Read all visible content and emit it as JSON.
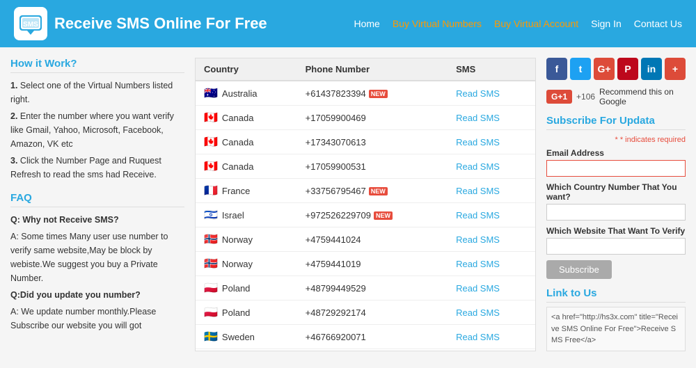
{
  "header": {
    "title": "Receive SMS Online For Free",
    "nav": [
      {
        "label": "Home",
        "class": "normal"
      },
      {
        "label": "Buy Virtual Numbers",
        "class": "orange"
      },
      {
        "label": "Buy Virtual Account",
        "class": "orange"
      },
      {
        "label": "Sign In",
        "class": "normal"
      },
      {
        "label": "Contact Us",
        "class": "normal"
      }
    ]
  },
  "left": {
    "howItWorks": {
      "title": "How it Work?",
      "steps": [
        {
          "num": "1.",
          "text": "Select one of the Virtual Numbers listed right."
        },
        {
          "num": "2.",
          "text": "Enter the number where you want verify like Gmail, Yahoo, Microsoft, Facebook, Amazon, VK etc"
        },
        {
          "num": "3.",
          "text": "Click the Number Page and Ruquest Refresh to read the sms had Receive."
        }
      ]
    },
    "faq": {
      "title": "FAQ",
      "items": [
        {
          "q": "Q: Why not Receive SMS?",
          "a": "A: Some times Many user use number to verify same website,May be block by webiste.We suggest you buy a Private Number."
        },
        {
          "q": "Q:Did you update you number?",
          "a": "A: We update number monthly.Please Subscribe our website you will got"
        }
      ]
    }
  },
  "table": {
    "columns": [
      "Country",
      "Phone Number",
      "SMS"
    ],
    "rows": [
      {
        "flag": "🇦🇺",
        "flagClass": "au",
        "country": "Australia",
        "phone": "+61437823394",
        "isNew": true,
        "sms": "Read SMS"
      },
      {
        "flag": "🇨🇦",
        "flagClass": "ca",
        "country": "Canada",
        "phone": "+17059900469",
        "isNew": false,
        "sms": "Read SMS"
      },
      {
        "flag": "🇨🇦",
        "flagClass": "ca",
        "country": "Canada",
        "phone": "+17343070613",
        "isNew": false,
        "sms": "Read SMS"
      },
      {
        "flag": "🇨🇦",
        "flagClass": "ca",
        "country": "Canada",
        "phone": "+17059900531",
        "isNew": false,
        "sms": "Read SMS"
      },
      {
        "flag": "🇫🇷",
        "flagClass": "fr",
        "country": "France",
        "phone": "+33756795467",
        "isNew": true,
        "sms": "Read SMS"
      },
      {
        "flag": "🇮🇱",
        "flagClass": "il",
        "country": "Israel",
        "phone": "+972526229709",
        "isNew": true,
        "sms": "Read SMS"
      },
      {
        "flag": "🇳🇴",
        "flagClass": "no",
        "country": "Norway",
        "phone": "+4759441024",
        "isNew": false,
        "sms": "Read SMS"
      },
      {
        "flag": "🇳🇴",
        "flagClass": "no",
        "country": "Norway",
        "phone": "+4759441019",
        "isNew": false,
        "sms": "Read SMS"
      },
      {
        "flag": "🇵🇱",
        "flagClass": "pl",
        "country": "Poland",
        "phone": "+48799449529",
        "isNew": false,
        "sms": "Read SMS"
      },
      {
        "flag": "🇵🇱",
        "flagClass": "pl",
        "country": "Poland",
        "phone": "+48729292174",
        "isNew": false,
        "sms": "Read SMS"
      },
      {
        "flag": "🇸🇪",
        "flagClass": "se",
        "country": "Sweden",
        "phone": "+46766920071",
        "isNew": false,
        "sms": "Read SMS"
      }
    ]
  },
  "sidebar": {
    "social": [
      {
        "label": "f",
        "class": "fb",
        "name": "facebook"
      },
      {
        "label": "t",
        "class": "tw",
        "name": "twitter"
      },
      {
        "label": "G+",
        "class": "gp",
        "name": "googleplus"
      },
      {
        "label": "P",
        "class": "pi",
        "name": "pinterest"
      },
      {
        "label": "in",
        "class": "li",
        "name": "linkedin"
      },
      {
        "label": "+",
        "class": "pl",
        "name": "more"
      }
    ],
    "googlePlus": {
      "btn": "G+1",
      "count": "+106",
      "text": "Recommend this on Google"
    },
    "subscribe": {
      "title": "Subscribe For Updata",
      "requiredNote": "* indicates required",
      "emailLabel": "Email Address",
      "emailPlaceholder": "",
      "countryLabel": "Which Country Number That You want?",
      "websiteLabel": "Which Website That Want To Verify",
      "btnLabel": "Subscribe"
    },
    "linkToUs": {
      "title": "Link to Us",
      "code": "<a href=\"http://hs3x.com\" title=\"Receive SMS Online For Free\">Receive SMS Free</a>"
    }
  }
}
